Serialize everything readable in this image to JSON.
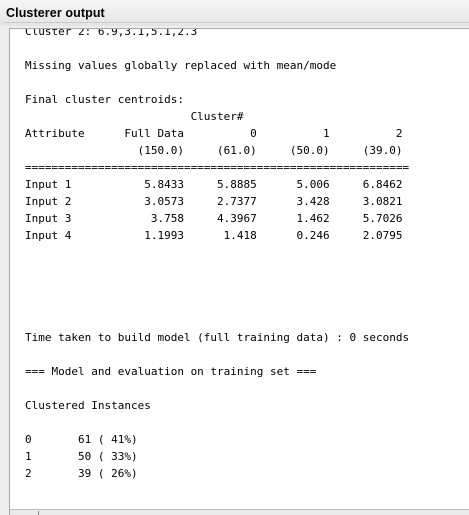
{
  "window": {
    "title": "Clusterer output"
  },
  "output": {
    "first_line": "Cluster 2: 6.9,3.1,5.1,2.3",
    "lines": [
      "",
      "Missing values globally replaced with mean/mode",
      "",
      "Final cluster centroids:",
      "                         Cluster#",
      "Attribute      Full Data          0          1          2",
      "                 (150.0)     (61.0)     (50.0)     (39.0)",
      "==========================================================",
      "Input 1           5.8433     5.8885      5.006     6.8462",
      "Input 2           3.0573     2.7377      3.428     3.0821",
      "Input 3            3.758     4.3967      1.462     5.7026",
      "Input 4           1.1993      1.418      0.246     2.0795",
      "",
      "",
      "",
      "",
      "",
      "Time taken to build model (full training data) : 0 seconds",
      "",
      "=== Model and evaluation on training set ===",
      "",
      "Clustered Instances",
      "",
      "0       61 ( 41%)",
      "1       50 ( 33%)",
      "2       39 ( 26%)"
    ]
  }
}
